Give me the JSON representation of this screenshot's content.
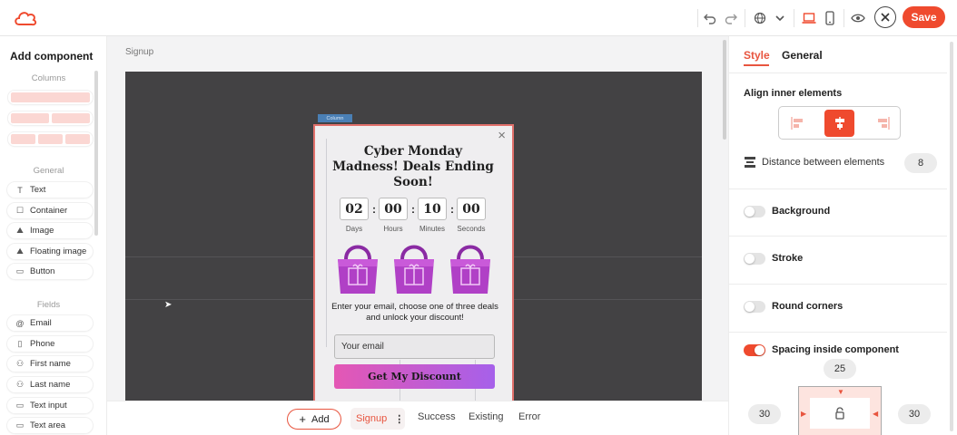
{
  "topbar": {
    "icons": [
      "undo-icon",
      "redo-icon",
      "globe-icon",
      "chevron-down-icon",
      "desktop-icon",
      "mobile-icon",
      "eye-icon",
      "close-icon"
    ],
    "save_label": "Save",
    "brand_color": "#ef4a2e"
  },
  "left_panel": {
    "title": "Add component",
    "columns_label": "Columns",
    "general_label": "General",
    "general_items": [
      {
        "icon": "T",
        "label": "Text"
      },
      {
        "icon": "☐",
        "label": "Container"
      },
      {
        "icon": "⛰",
        "label": "Image"
      },
      {
        "icon": "⛰",
        "label": "Floating image"
      },
      {
        "icon": "▭",
        "label": "Button"
      }
    ],
    "fields_label": "Fields",
    "field_items": [
      {
        "icon": "@",
        "label": "Email"
      },
      {
        "icon": "▯",
        "label": "Phone"
      },
      {
        "icon": "⚇",
        "label": "First name"
      },
      {
        "icon": "⚇",
        "label": "Last name"
      },
      {
        "icon": "▭",
        "label": "Text input"
      },
      {
        "icon": "▭",
        "label": "Text area"
      }
    ]
  },
  "canvas": {
    "page_label": "Signup",
    "column_tag": "Column",
    "popup": {
      "title": "Cyber Monday Madness! Deals Ending Soon!",
      "close": "×",
      "timer": [
        {
          "value": "02",
          "label": "Days"
        },
        {
          "value": "00",
          "label": "Hours"
        },
        {
          "value": "10",
          "label": "Minutes"
        },
        {
          "value": "00",
          "label": "Seconds"
        }
      ],
      "colon": ":",
      "description": "Enter your email, choose one of three deals and unlock your discount!",
      "email_placeholder": "Your email",
      "cta_label": "Get My Discount"
    }
  },
  "bottombar": {
    "add_label": "Add",
    "steps": [
      "Signup",
      "Success",
      "Existing",
      "Error"
    ],
    "active_step": "Signup",
    "more": "⋮"
  },
  "right_panel": {
    "tabs": [
      "Style",
      "General"
    ],
    "active_tab": "Style",
    "align_heading": "Align inner elements",
    "distance_label": "Distance between elements",
    "distance_value": "8",
    "toggles": [
      {
        "label": "Background",
        "on": false
      },
      {
        "label": "Stroke",
        "on": false
      },
      {
        "label": "Round corners",
        "on": false
      },
      {
        "label": "Spacing inside component",
        "on": true
      }
    ],
    "spacing": {
      "top": "25",
      "left": "30",
      "right": "30"
    }
  }
}
